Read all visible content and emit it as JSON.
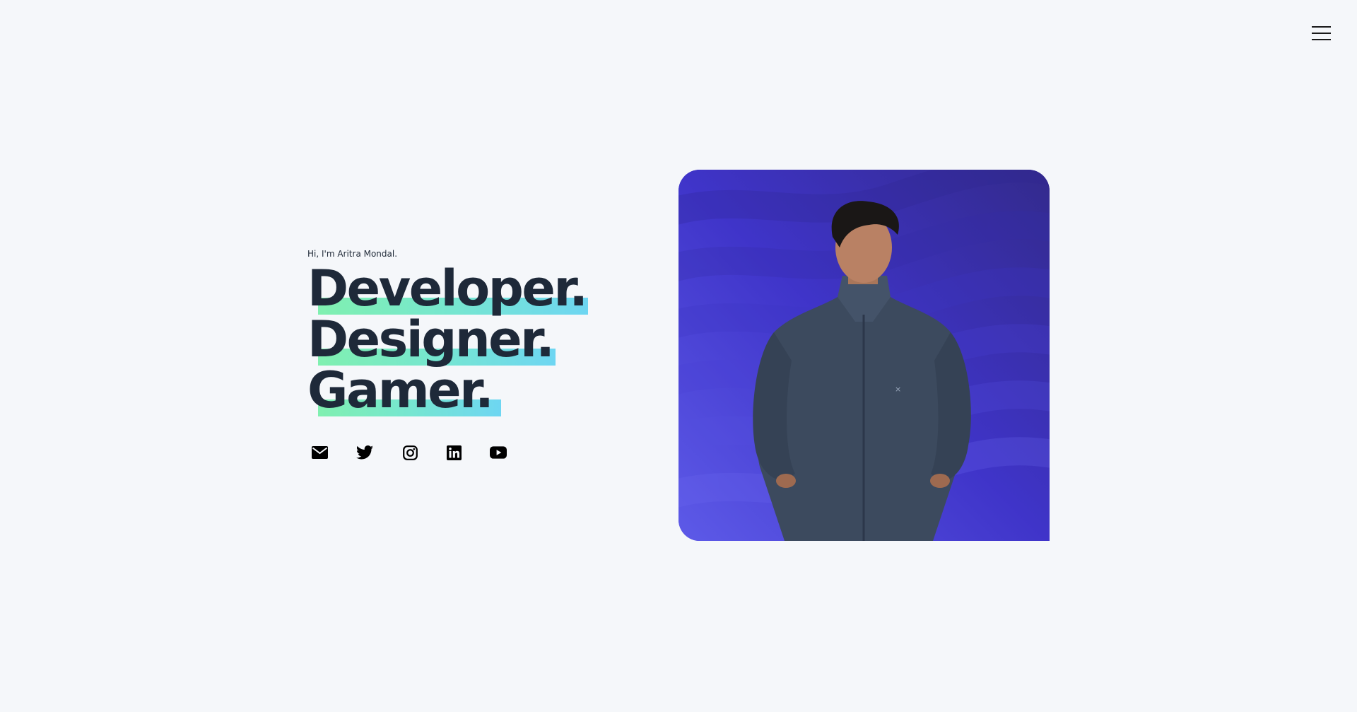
{
  "nav": {
    "menu_icon": "hamburger-menu-icon"
  },
  "hero": {
    "intro": "Hi, I'm Aritra Mondal.",
    "headline": [
      "Developer.",
      "Designer.",
      "Gamer."
    ],
    "highlight_colors": [
      "#80f0b0",
      "#6ed6f2"
    ],
    "text_color": "#1e2939"
  },
  "socials": [
    {
      "name": "email",
      "icon": "envelope-icon"
    },
    {
      "name": "twitter",
      "icon": "twitter-icon"
    },
    {
      "name": "instagram",
      "icon": "instagram-icon"
    },
    {
      "name": "linkedin",
      "icon": "linkedin-icon"
    },
    {
      "name": "youtube",
      "icon": "youtube-icon"
    }
  ],
  "portrait": {
    "image": "profile-photo",
    "background_colors": [
      "#5d5ae8",
      "#3f34c9",
      "#332a8c"
    ]
  }
}
